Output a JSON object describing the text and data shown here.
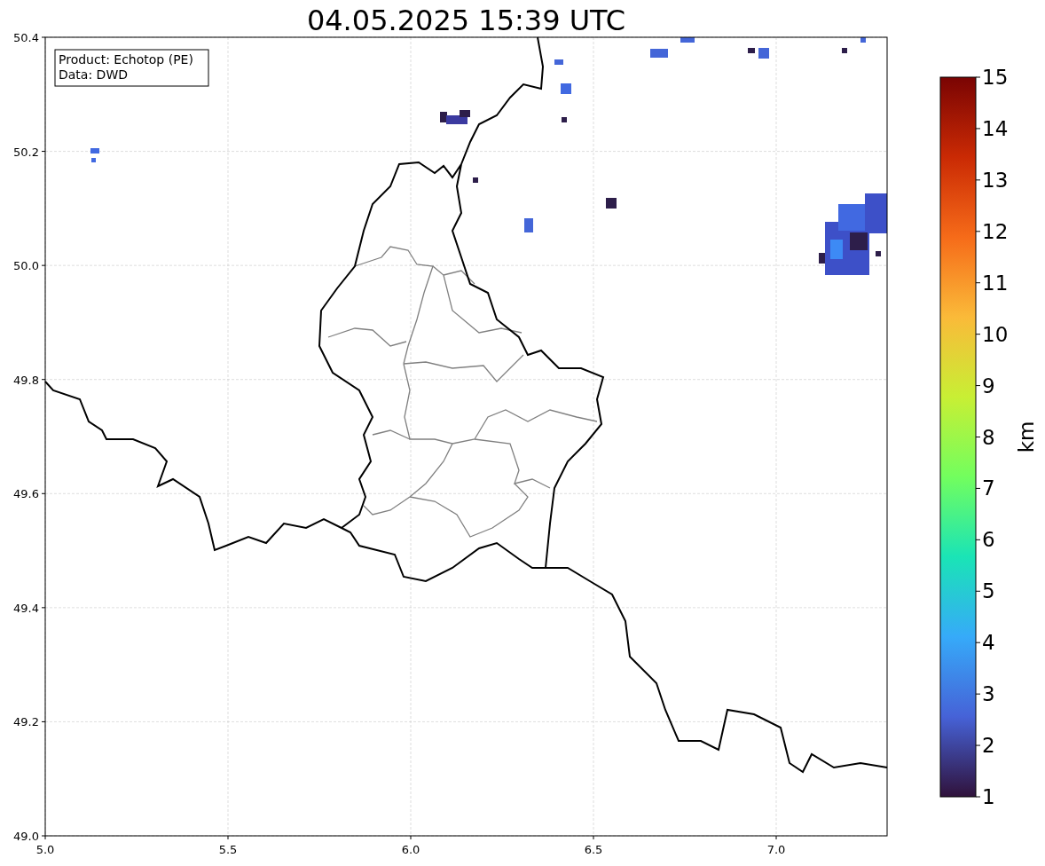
{
  "title": "04.05.2025 15:39 UTC",
  "info_box": {
    "lines": [
      "Product: Echotop (PE)",
      "Data: DWD"
    ]
  },
  "x_axis": {
    "ticks": [
      "5.0",
      "5.5",
      "6.0",
      "6.5",
      "7.0"
    ]
  },
  "y_axis": {
    "ticks": [
      "50.4",
      "50.2",
      "50.0",
      "49.8",
      "49.6",
      "49.4",
      "49.2",
      "49.0"
    ]
  },
  "colorbar": {
    "label": "km",
    "ticks": [
      "15",
      "14",
      "13",
      "12",
      "11",
      "10",
      "9",
      "8",
      "7",
      "6",
      "5",
      "4",
      "3",
      "2",
      "1"
    ]
  }
}
